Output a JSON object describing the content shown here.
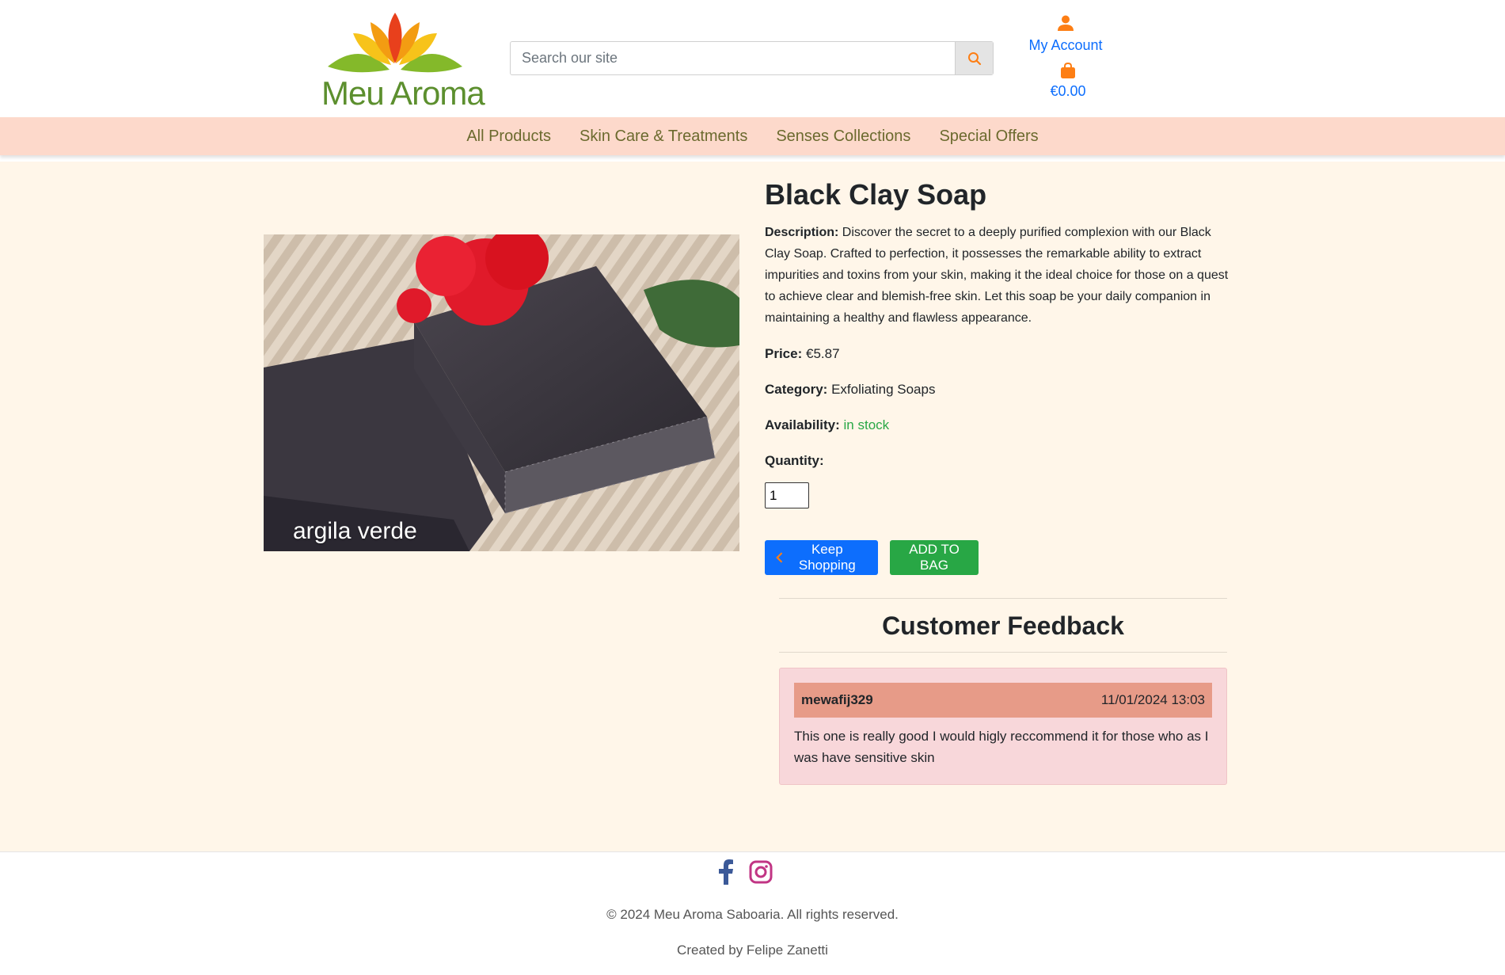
{
  "brand": {
    "name": "Meu Aroma"
  },
  "header": {
    "search_placeholder": "Search our site",
    "account_label": "My Account",
    "bag_total": "€0.00"
  },
  "nav": {
    "items": [
      {
        "label": "All Products"
      },
      {
        "label": "Skin Care & Treatments"
      },
      {
        "label": "Senses Collections"
      },
      {
        "label": "Special Offers"
      }
    ]
  },
  "product": {
    "title": "Black Clay Soap",
    "image_caption": "argila verde",
    "description_label": "Description:",
    "description": "Discover the secret to a deeply purified complexion with our Black Clay Soap. Crafted to perfection, it possesses the remarkable ability to extract impurities and toxins from your skin, making it the ideal choice for those on a quest to achieve clear and blemish-free skin. Let this soap be your daily companion in maintaining a healthy and flawless appearance.",
    "price_label": "Price:",
    "price": "€5.87",
    "category_label": "Category:",
    "category": "Exfoliating Soaps",
    "availability_label": "Availability:",
    "availability": "in stock",
    "quantity_label": "Quantity:",
    "quantity": "1",
    "keep_shopping_label": "Keep Shopping",
    "add_to_bag_label": "ADD TO BAG"
  },
  "feedback": {
    "title": "Customer Feedback",
    "reviews": [
      {
        "author": "mewafij329",
        "date": "11/01/2024 13:03",
        "text": "This one is really good I would higly reccommend it for those who as I was have sensitive skin"
      }
    ]
  },
  "footer": {
    "copyright": "© 2024 Meu Aroma Saboaria. All rights reserved.",
    "credits": "Created by Felipe Zanetti"
  },
  "colors": {
    "nav_bg": "#fdd9cb",
    "main_bg": "#fff6e9",
    "link_blue": "#0d6efd",
    "accent_orange": "#fd7e14",
    "success_green": "#28a745",
    "review_header": "#e79b88",
    "review_bg": "#f8d7da"
  },
  "icons": {
    "search": "search-icon",
    "account": "user-icon",
    "bag": "shopping-bag-icon",
    "keep_shopping": "chevron-left-icon",
    "facebook": "facebook-icon",
    "instagram": "instagram-icon"
  }
}
